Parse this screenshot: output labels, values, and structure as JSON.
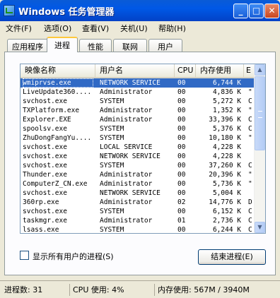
{
  "window": {
    "title": "Windows 任务管理器",
    "buttons": {
      "minimize": "_",
      "maximize": "□",
      "close": "✕"
    }
  },
  "menu": [
    {
      "label": "文件(F)"
    },
    {
      "label": "选项(O)"
    },
    {
      "label": "查看(V)"
    },
    {
      "label": "关机(U)"
    },
    {
      "label": "帮助(H)"
    }
  ],
  "tabs": [
    {
      "label": "应用程序",
      "active": false
    },
    {
      "label": "进程",
      "active": true
    },
    {
      "label": "性能",
      "active": false
    },
    {
      "label": "联网",
      "active": false
    },
    {
      "label": "用户",
      "active": false
    }
  ],
  "columns": [
    "映像名称",
    "用户名",
    "CPU",
    "内存使用",
    "E"
  ],
  "processes": [
    {
      "name": "wmiprvse.exe",
      "user": "NETWORK SERVICE",
      "cpu": "00",
      "mem": "6,744 K",
      "extra": "",
      "selected": true
    },
    {
      "name": "LiveUpdate360....",
      "user": "Administrator",
      "cpu": "00",
      "mem": "4,836 K",
      "extra": "\""
    },
    {
      "name": "svchost.exe",
      "user": "SYSTEM",
      "cpu": "00",
      "mem": "5,272 K",
      "extra": "C"
    },
    {
      "name": "TXPlatform.exe",
      "user": "Administrator",
      "cpu": "00",
      "mem": "1,352 K",
      "extra": "\""
    },
    {
      "name": "Explorer.EXE",
      "user": "Administrator",
      "cpu": "00",
      "mem": "33,396 K",
      "extra": "C"
    },
    {
      "name": "spoolsv.exe",
      "user": "SYSTEM",
      "cpu": "00",
      "mem": "5,376 K",
      "extra": "C"
    },
    {
      "name": "ZhuDongFangYu....",
      "user": "SYSTEM",
      "cpu": "00",
      "mem": "10,180 K",
      "extra": "\""
    },
    {
      "name": "svchost.exe",
      "user": "LOCAL SERVICE",
      "cpu": "00",
      "mem": "4,228 K",
      "extra": ""
    },
    {
      "name": "svchost.exe",
      "user": "NETWORK SERVICE",
      "cpu": "00",
      "mem": "4,228 K",
      "extra": ""
    },
    {
      "name": "svchost.exe",
      "user": "SYSTEM",
      "cpu": "00",
      "mem": "37,260 K",
      "extra": "C"
    },
    {
      "name": "Thunder.exe",
      "user": "Administrator",
      "cpu": "00",
      "mem": "20,396 K",
      "extra": "\""
    },
    {
      "name": "ComputerZ_CN.exe",
      "user": "Administrator",
      "cpu": "00",
      "mem": "5,736 K",
      "extra": "\""
    },
    {
      "name": "svchost.exe",
      "user": "NETWORK SERVICE",
      "cpu": "00",
      "mem": "5,004 K",
      "extra": ""
    },
    {
      "name": "360rp.exe",
      "user": "Administrator",
      "cpu": "02",
      "mem": "14,776 K",
      "extra": "D"
    },
    {
      "name": "svchost.exe",
      "user": "SYSTEM",
      "cpu": "00",
      "mem": "6,152 K",
      "extra": "C"
    },
    {
      "name": "taskmgr.exe",
      "user": "Administrator",
      "cpu": "01",
      "mem": "2,736 K",
      "extra": "C"
    },
    {
      "name": "lsass.exe",
      "user": "SYSTEM",
      "cpu": "00",
      "mem": "6,244 K",
      "extra": "C"
    }
  ],
  "show_all_users": {
    "label": "显示所有用户的进程(S)",
    "checked": false
  },
  "end_process_label": "结束进程(E)",
  "status": {
    "processes": "进程数: 31",
    "cpu": "CPU 使用: 4%",
    "memory": "内存使用: 567M / 3940M"
  },
  "colors": {
    "selection": "#316AC5",
    "titlebar": "#0058E6"
  }
}
